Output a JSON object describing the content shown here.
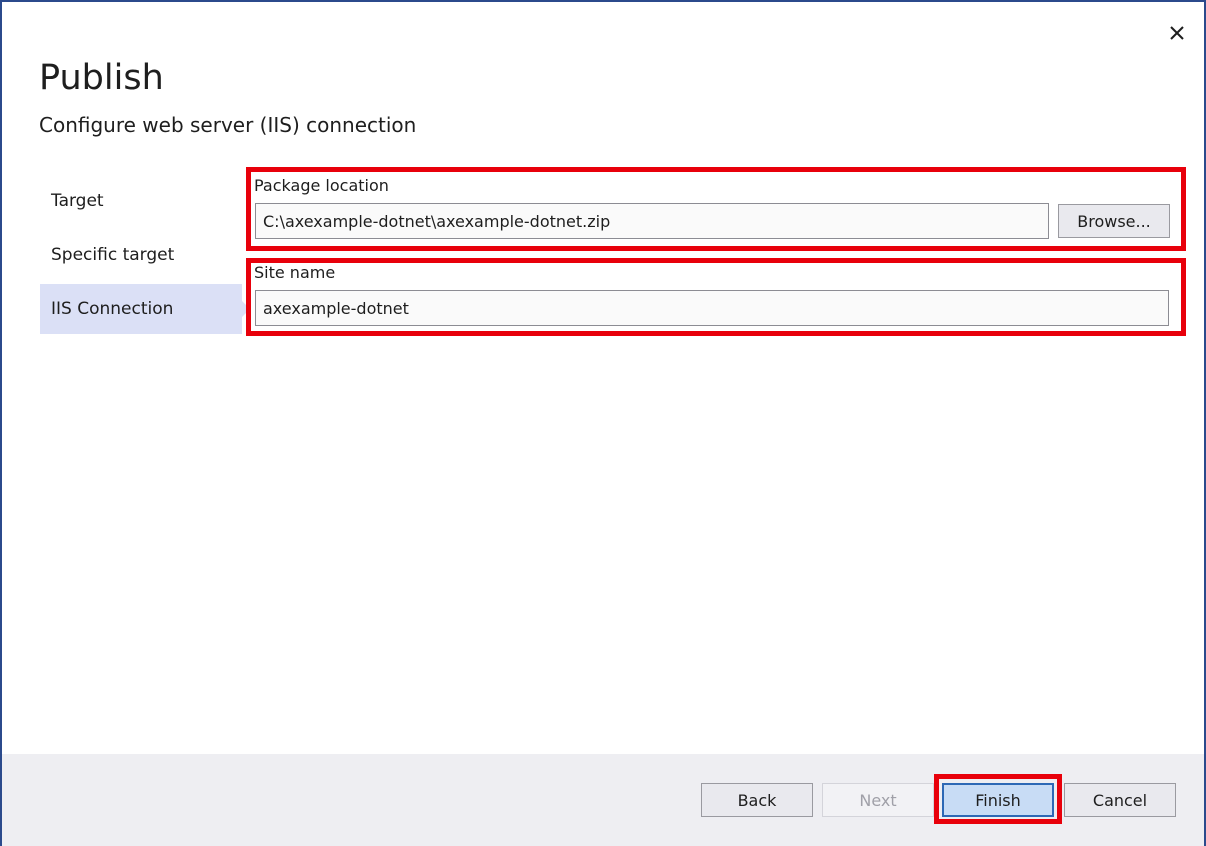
{
  "dialog": {
    "title": "Publish",
    "subtitle": "Configure web server (IIS) connection",
    "close_icon": "close-icon",
    "close_glyph": "✕"
  },
  "nav": {
    "items": [
      {
        "label": "Target",
        "active": false
      },
      {
        "label": "Specific target",
        "active": false
      },
      {
        "label": "IIS Connection",
        "active": true
      }
    ]
  },
  "form": {
    "package_location": {
      "label": "Package location",
      "value": "C:\\axexample-dotnet\\axexample-dotnet.zip"
    },
    "browse_label": "Browse...",
    "site_name": {
      "label": "Site name",
      "value": "axexample-dotnet"
    }
  },
  "footer": {
    "back_label": "Back",
    "next_label": "Next",
    "finish_label": "Finish",
    "cancel_label": "Cancel"
  },
  "colors": {
    "highlight": "#e8000b",
    "nav_active": "#dbe0f6",
    "primary_button": "#c8dcf5",
    "dialog_border": "#2b4a8c"
  }
}
